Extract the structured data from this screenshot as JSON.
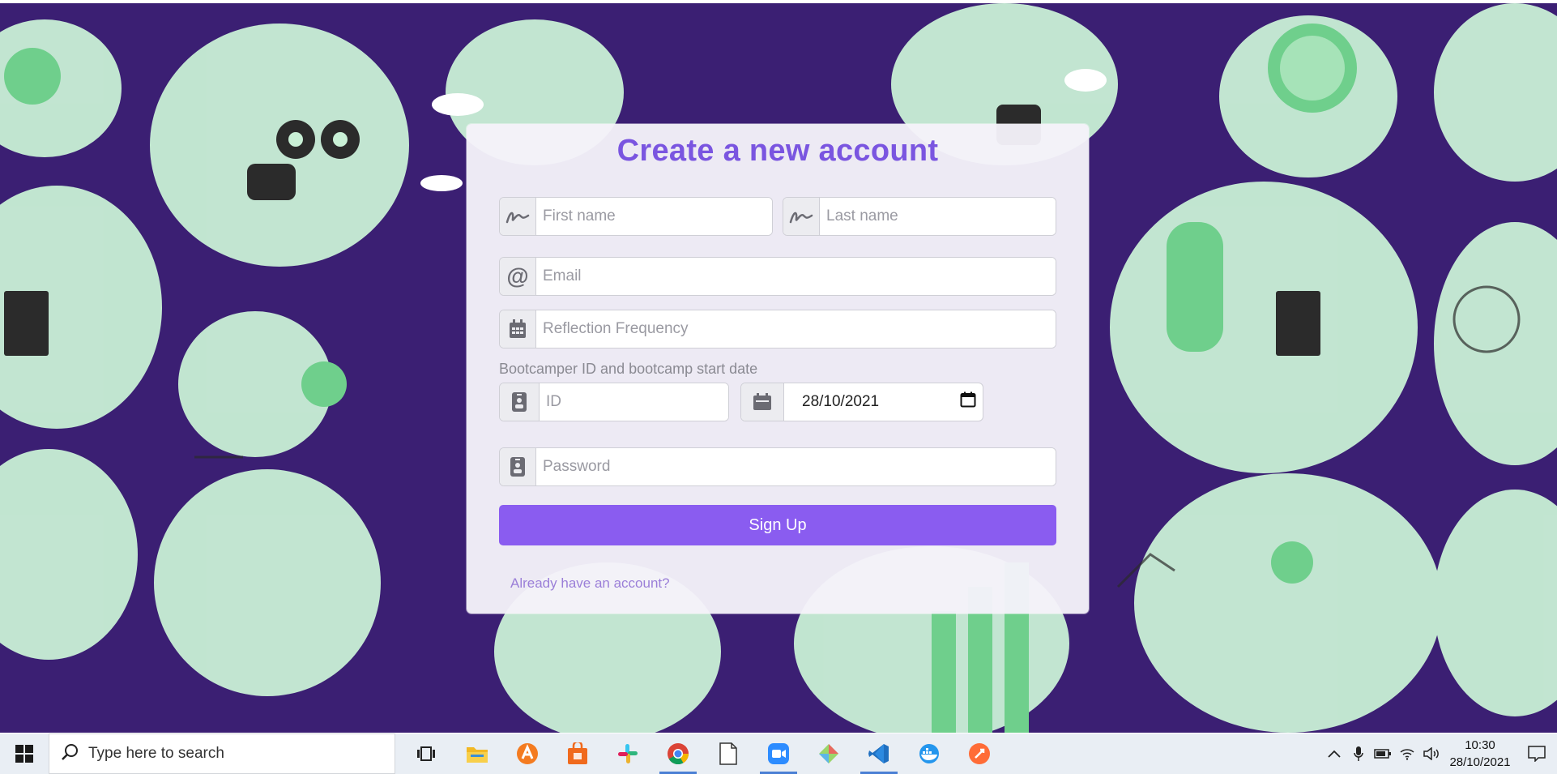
{
  "form": {
    "title": "Create a new account",
    "first_name_placeholder": "First name",
    "last_name_placeholder": "Last name",
    "email_placeholder": "Email",
    "reflection_placeholder": "Reflection Frequency",
    "bootcamp_label": "Bootcamper ID and bootcamp start date",
    "id_placeholder": "ID",
    "start_date_value": "28/10/2021",
    "password_placeholder": "Password",
    "signup_label": "Sign Up",
    "login_link": "Already have an account?",
    "icons": {
      "name": "signature-icon",
      "email": "at-sign-icon",
      "frequency": "calendar-icon",
      "id": "id-badge-icon",
      "date": "calendar-icon",
      "password": "id-badge-icon",
      "date_picker": "calendar-picker-icon"
    }
  },
  "taskbar": {
    "search_placeholder": "Type here to search",
    "apps": [
      {
        "name": "task-view-icon"
      },
      {
        "name": "file-explorer-icon"
      },
      {
        "name": "avast-icon"
      },
      {
        "name": "store-icon"
      },
      {
        "name": "slack-icon"
      },
      {
        "name": "chrome-icon",
        "active": true
      },
      {
        "name": "notepad-icon"
      },
      {
        "name": "zoom-icon",
        "active": true
      },
      {
        "name": "gitkraken-icon"
      },
      {
        "name": "vscode-icon",
        "active": true
      },
      {
        "name": "docker-icon"
      },
      {
        "name": "postman-icon"
      }
    ],
    "time": "10:30",
    "date": "28/10/2021"
  },
  "colors": {
    "background": "#3b1f73",
    "accent": "#8a5cf0",
    "title": "#7a55e0",
    "illustration_green": "#b8eccb"
  }
}
